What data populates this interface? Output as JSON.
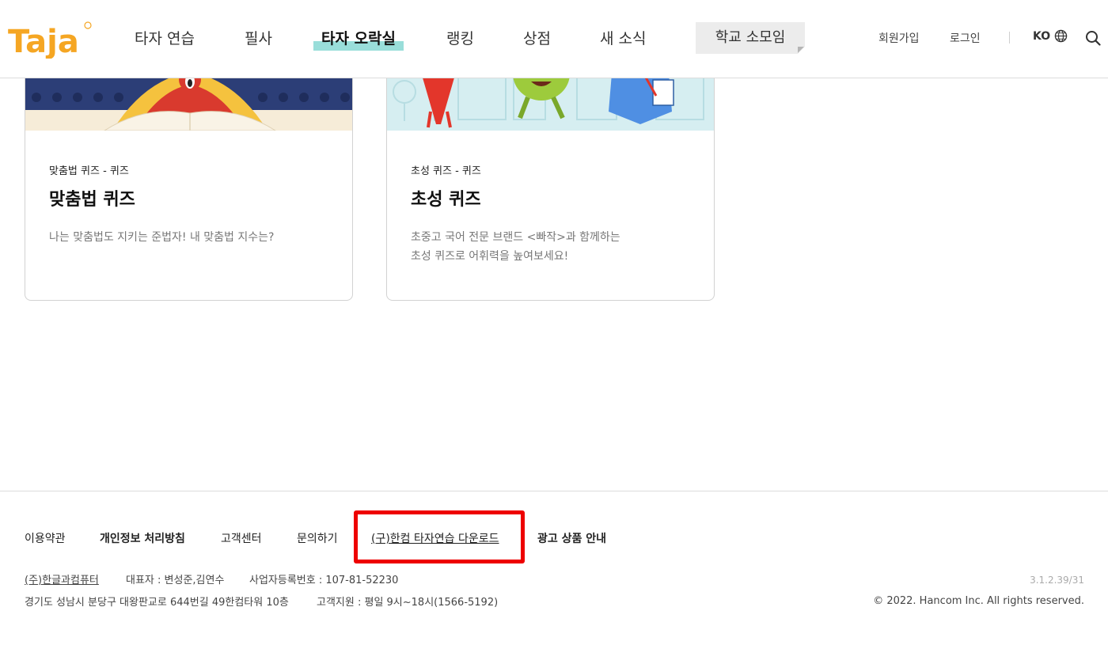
{
  "header": {
    "logo_text": "Taja",
    "nav": [
      {
        "label": "타자 연습"
      },
      {
        "label": "필사"
      },
      {
        "label": "타자 오락실"
      },
      {
        "label": "랭킹"
      },
      {
        "label": "상점"
      },
      {
        "label": "새 소식"
      }
    ],
    "school_label": "학교 소모임",
    "signup": "회원가입",
    "login": "로그인",
    "lang": "KO"
  },
  "cards": [
    {
      "category": "맞춤법 퀴즈 - 퀴즈",
      "title": "맞춤법 퀴즈",
      "description": "나는 맞춤법도 지키는 준법자! 내 맞춤법 지수는?"
    },
    {
      "category": "초성 퀴즈 - 퀴즈",
      "title": "초성 퀴즈",
      "description": "초중고 국어 전문 브랜드 <빠작>과 함께하는\n초성 퀴즈로 어휘력을 높여보세요!"
    }
  ],
  "footer": {
    "links": [
      {
        "label": "이용약관"
      },
      {
        "label": "개인정보 처리방침"
      },
      {
        "label": "고객센터"
      },
      {
        "label": "문의하기"
      },
      {
        "label": "(구)한컴 타자연습 다운로드"
      },
      {
        "label": "광고 상품 안내"
      }
    ],
    "company": "(주)한글과컴퓨터",
    "ceo": "대표자 : 변성준,김연수",
    "business_no": "사업자등록번호 : 107-81-52230",
    "address": "경기도 성남시 분당구 대왕판교로 644번길 49한컴타워 10층",
    "support": "고객지원 : 평일 9시~18시(1566-5192)",
    "version": "3.1.2.39/31",
    "copyright": "© 2022. Hancom Inc. All rights reserved."
  },
  "colors": {
    "logo": "#f5a623",
    "highlight": "#7fd6d1",
    "annotation": "#ee0000"
  }
}
